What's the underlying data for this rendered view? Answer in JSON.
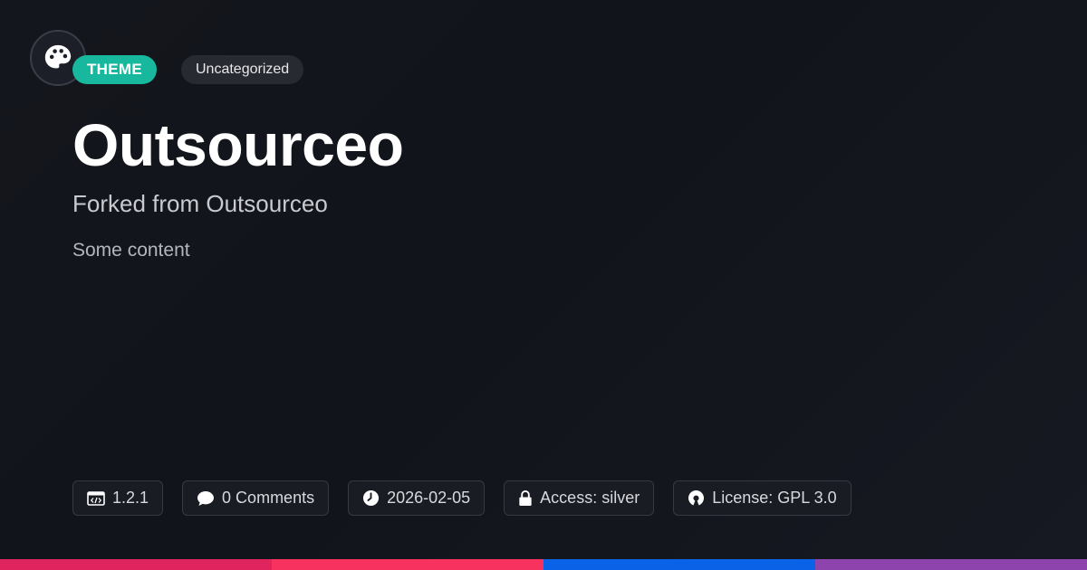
{
  "logo": {
    "icon": "palette-icon"
  },
  "badges": {
    "type_label": "THEME",
    "category_label": "Uncategorized"
  },
  "header": {
    "title": "Outsourceo",
    "subtitle": "Forked from Outsourceo",
    "content": "Some content"
  },
  "meta": {
    "version": {
      "icon": "code-icon",
      "label": "1.2.1"
    },
    "comments": {
      "icon": "comment-icon",
      "label": "0 Comments"
    },
    "date": {
      "icon": "clock-icon",
      "label": "2026-02-05"
    },
    "access": {
      "icon": "lock-icon",
      "label": "Access: silver"
    },
    "license": {
      "icon": "open-source-icon",
      "label": "License: GPL 3.0"
    }
  },
  "colors": {
    "accent": "#18b89e",
    "bar": [
      "#e0245e",
      "#f7325f",
      "#0a63e6",
      "#8e44ad"
    ]
  }
}
